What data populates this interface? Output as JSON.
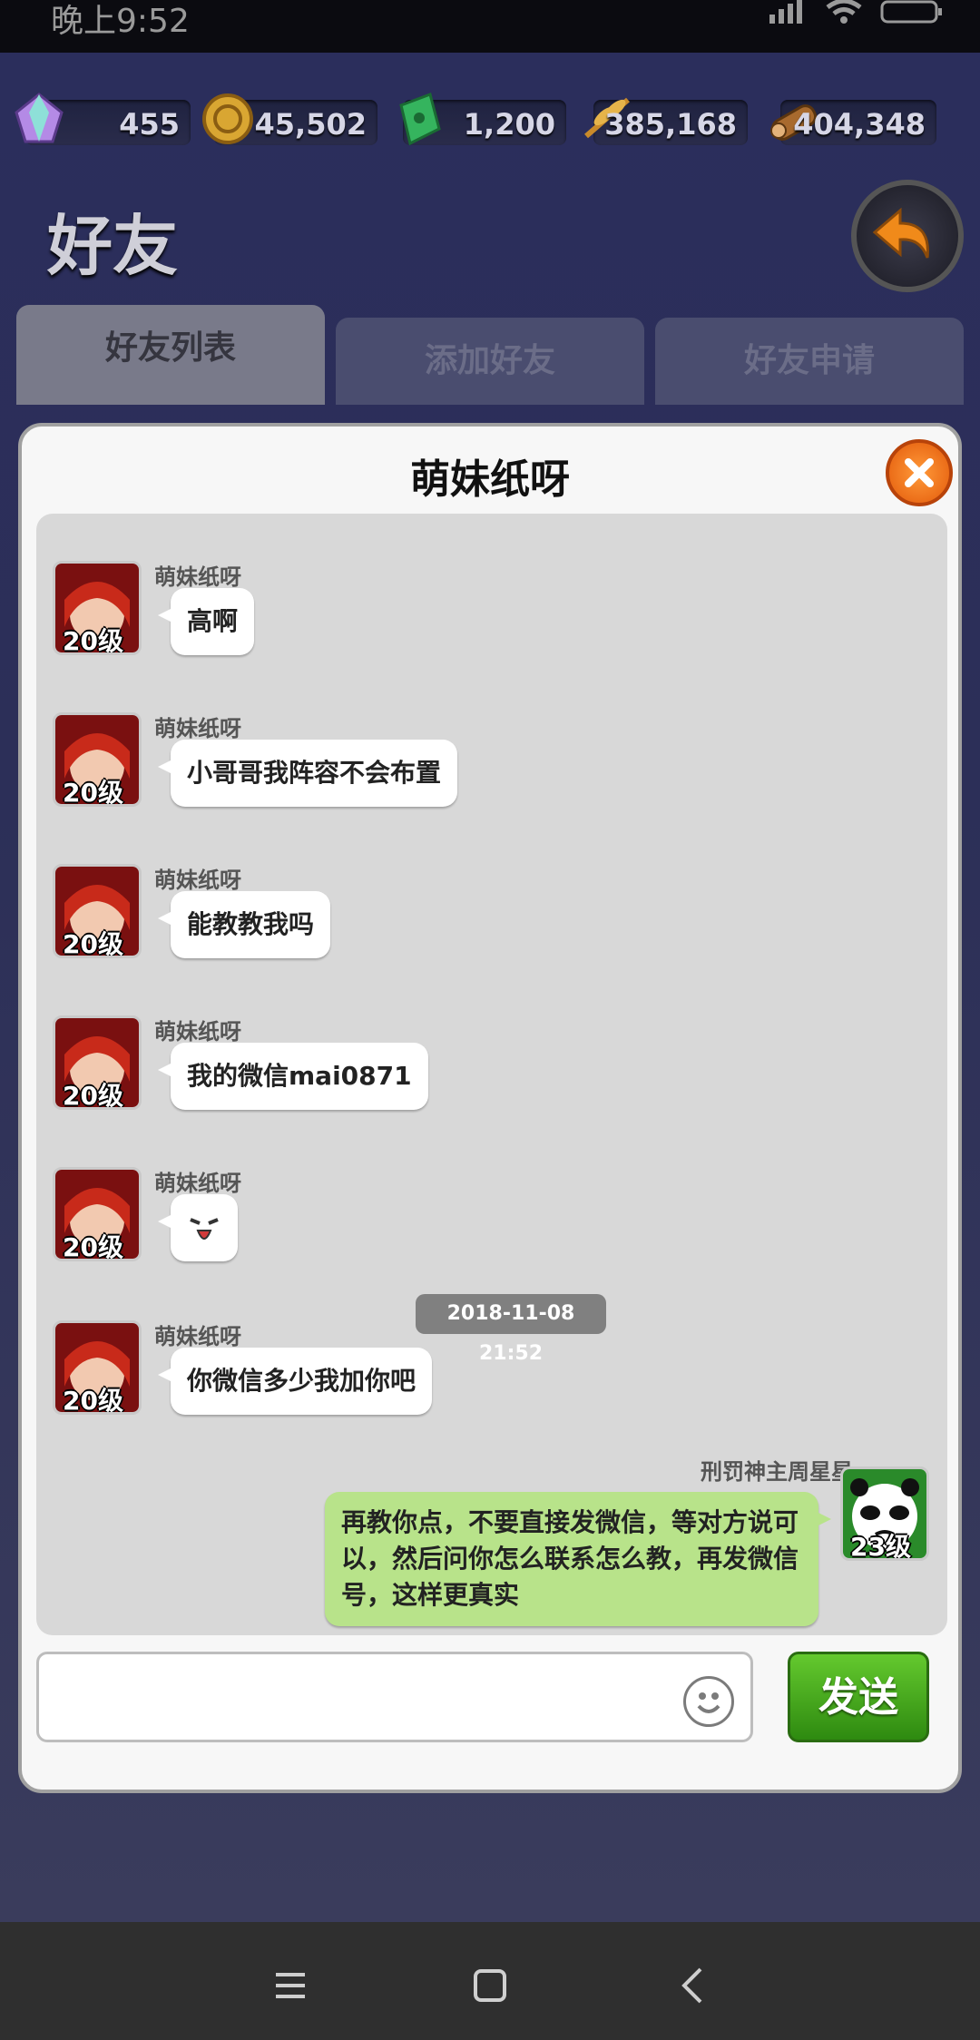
{
  "status_bar": {
    "time": "晚上9:52"
  },
  "resources": [
    {
      "name": "gem",
      "value": "455"
    },
    {
      "name": "coin",
      "value": "45,502"
    },
    {
      "name": "jade",
      "value": "1,200"
    },
    {
      "name": "grain",
      "value": "385,168"
    },
    {
      "name": "wood",
      "value": "404,348"
    }
  ],
  "page_title": "好友",
  "tabs": [
    {
      "label": "好友列表"
    },
    {
      "label": "添加好友"
    },
    {
      "label": "好友申请"
    }
  ],
  "chat": {
    "title": "萌妹纸呀",
    "messages": [
      {
        "sender": "萌妹纸呀",
        "level": "20级",
        "text": "高啊"
      },
      {
        "sender": "萌妹纸呀",
        "level": "20级",
        "text": "小哥哥我阵容不会布置"
      },
      {
        "sender": "萌妹纸呀",
        "level": "20级",
        "text": "能教教我吗"
      },
      {
        "sender": "萌妹纸呀",
        "level": "20级",
        "text": "我的微信mai0871"
      },
      {
        "sender": "萌妹纸呀",
        "level": "20级",
        "text": "ヾ"
      },
      {
        "sender": "萌妹纸呀",
        "level": "20级",
        "text": "你微信多少我加你吧"
      }
    ],
    "timestamp": "2018-11-08 21:52",
    "my_message": {
      "sender": "刑罚神主周星星",
      "level": "23级",
      "text": "再教你点，不要直接发微信，等对方说可以，然后问你怎么联系怎么教，再发微信号，这样更真实"
    },
    "send_label": "发送"
  },
  "colors": {
    "send_green": "#3fa61c",
    "close_orange": "#f07a1d",
    "my_bubble": "#b8e38a"
  }
}
